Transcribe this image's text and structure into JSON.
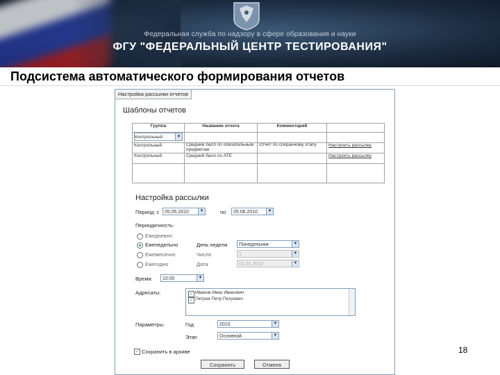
{
  "banner": {
    "org_line1": "Федеральная служба по надзору в сфере образования и науки",
    "org_line2": "ФГУ \"ФЕДЕРАЛЬНЫЙ ЦЕНТР ТЕСТИРОВАНИЯ\""
  },
  "slide": {
    "title": "Подсистема автоматического формирования отчетов",
    "page_number": "18"
  },
  "dialog": {
    "tab_label": "Настройка рассылки отчетов",
    "templates": {
      "heading": "Шаблоны отчетов",
      "columns": [
        "Группа",
        "Название отчета",
        "Комментарий",
        ""
      ],
      "rows": [
        {
          "group": "Контрольный",
          "name": "",
          "comment": "",
          "action": ""
        },
        {
          "group": "Контрольный",
          "name": "Средний балл по обязательным предметам",
          "comment": "Отчет по сохранному этапу",
          "action": "Настроить рассылку"
        },
        {
          "group": "Контрольный",
          "name": "Средний балл по АТЕ",
          "comment": "",
          "action": "Настроить рассылку"
        }
      ]
    },
    "mailing": {
      "heading": "Настройка рассылки",
      "period_label": "Период: с",
      "period_from": "05.05.2010",
      "period_to_label": "по",
      "period_to": "05.06.2010",
      "frequency_label": "Периодичность:",
      "frequency_options": [
        "Ежедневно",
        "Еженедельно",
        "Ежемесячно",
        "Ежегодно"
      ],
      "frequency_selected": "Еженедельно",
      "weekday_label": "День недели",
      "weekday_value": "Понедельник",
      "number_label": "Число",
      "number_value": "1",
      "date_label": "Дата",
      "date_value": "01.01.2010",
      "time_label": "Время:",
      "time_value": "10:00",
      "recipients_label": "Адресаты:",
      "recipients": [
        "Иванов Иван Иванович",
        "Петров Петр Петрович"
      ],
      "params_label": "Параметры:",
      "year_label": "Год",
      "year_value": "2010",
      "stage_label": "Этап",
      "stage_value": "Основной",
      "archive_label": "Сохранить в архиве",
      "save_button": "Сохранить",
      "cancel_button": "Отмена"
    }
  },
  "colors": {
    "banner_dark": "#1c2b3f",
    "dialog_border": "#7f9db9",
    "radio_selected": "#22aa44"
  },
  "icons": {
    "emblem": "state-emblem-icon",
    "dropdown": "chevron-down-icon",
    "checkbox": "checkmark-icon"
  }
}
